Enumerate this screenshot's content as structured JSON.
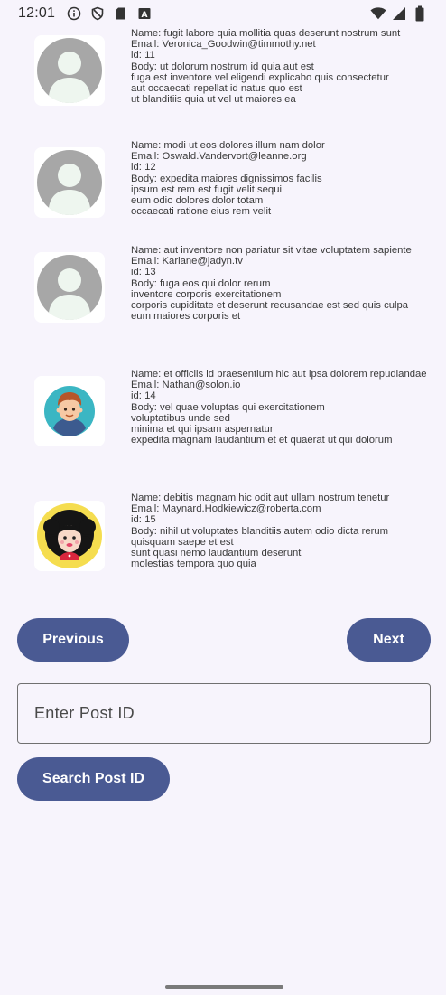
{
  "status_bar": {
    "time": "12:01"
  },
  "posts": [
    {
      "avatar": "default-person-icon",
      "text": "Name: fugit labore quia mollitia quas deserunt nostrum sunt\nEmail: Veronica_Goodwin@timmothy.net\nid: 11\nBody: ut dolorum nostrum id quia aut est\nfuga est inventore vel eligendi explicabo quis consectetur\naut occaecati repellat id natus quo est\nut blanditiis quia ut vel ut maiores ea"
    },
    {
      "avatar": "default-person-icon",
      "text": "Name: modi ut eos dolores illum nam dolor\nEmail: Oswald.Vandervort@leanne.org\nid: 12\nBody: expedita maiores dignissimos facilis\nipsum est rem est fugit velit sequi\neum odio dolores dolor totam\noccaecati ratione eius rem velit"
    },
    {
      "avatar": "default-person-icon",
      "text": "Name: aut inventore non pariatur sit vitae voluptatem sapiente\nEmail: Kariane@jadyn.tv\nid: 13\nBody: fuga eos qui dolor rerum\ninventore corporis exercitationem\ncorporis cupiditate et deserunt recusandae est sed quis culpa\neum maiores corporis et"
    },
    {
      "avatar": "boy-avatar-icon",
      "text": "Name: et officiis id praesentium hic aut ipsa dolorem repudiandae\nEmail: Nathan@solon.io\nid: 14\nBody: vel quae voluptas qui exercitationem\nvoluptatibus unde sed\nminima et qui ipsam aspernatur\nexpedita magnam laudantium et et quaerat ut qui dolorum"
    },
    {
      "avatar": "girl-avatar-icon",
      "text": "Name: debitis magnam hic odit aut ullam nostrum tenetur\nEmail: Maynard.Hodkiewicz@roberta.com\nid: 15\nBody: nihil ut voluptates blanditiis autem odio dicta rerum\nquisquam saepe et est\nsunt quasi nemo laudantium deserunt\nmolestias tempora quo quia"
    }
  ],
  "pagination": {
    "previous_label": "Previous",
    "next_label": "Next"
  },
  "search": {
    "placeholder": "Enter Post ID",
    "button_label": "Search Post ID"
  },
  "colors": {
    "background": "#f7f4fc",
    "button": "#4a5a93",
    "button_text": "#ffffff"
  }
}
